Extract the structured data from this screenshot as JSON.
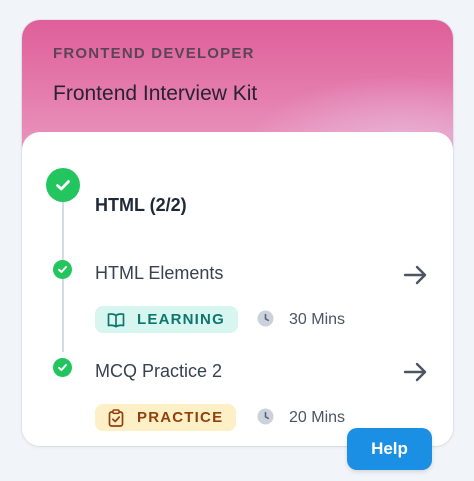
{
  "kit": {
    "eyebrow": "FRONTEND DEVELOPER",
    "title": "Frontend Interview Kit"
  },
  "section": {
    "title": "HTML (2/2)",
    "icon": "check-circle-icon",
    "status": "completed"
  },
  "items": [
    {
      "title": "HTML Elements",
      "badge": "LEARNING",
      "badge_icon": "book-open-icon",
      "duration": "30 Mins",
      "status": "completed"
    },
    {
      "title": "MCQ Practice 2",
      "badge": "PRACTICE",
      "badge_icon": "clipboard-check-icon",
      "duration": "20 Mins",
      "status": "completed"
    }
  ],
  "help_label": "Help",
  "colors": {
    "success": "#22c55e",
    "learning_bg": "#d7f6ef",
    "learning_fg": "#0f766e",
    "practice_bg": "#fdf0c6",
    "practice_fg": "#92400e",
    "help_bg": "#1a8fe3",
    "header_pink": "#df5f99"
  }
}
